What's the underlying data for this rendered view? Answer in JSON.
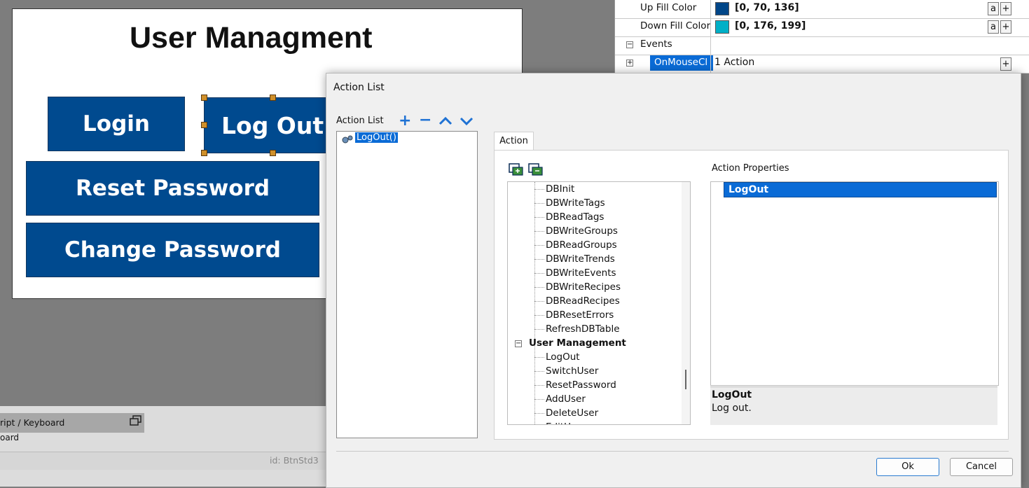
{
  "hmi": {
    "title": "User Managment",
    "buttons": {
      "login": "Login",
      "logout": "Log Out",
      "reset_password": "Reset Password",
      "change_password": "Change Password"
    }
  },
  "properties": {
    "up_fill_color": {
      "label": "Up Fill Color",
      "value": "[0, 70, 136]",
      "color": "#004688"
    },
    "down_fill_color": {
      "label": "Down Fill Color",
      "value": "[0, 176, 199]",
      "color": "#00b0c7"
    },
    "events": {
      "label": "Events"
    },
    "on_mouse_click": {
      "label": "OnMouseCl",
      "value": "1 Action"
    },
    "mini_a": "a",
    "mini_plus": "+",
    "expand_minus": "−",
    "expand_plus": "+"
  },
  "bottom_panel": {
    "tab_label": "ript / Keyboard",
    "sub_tab": "oard",
    "status_id": "id:  BtnStd3"
  },
  "dialog": {
    "title": "Action List",
    "action_list_label": "Action List",
    "toolbar": {
      "add": "+",
      "remove": "−",
      "up": "⌃",
      "down": "⌄"
    },
    "action_list_items": [
      "LogOut()"
    ],
    "tab_action": "Action",
    "tree": {
      "items": [
        "DBInit",
        "DBWriteTags",
        "DBReadTags",
        "DBWriteGroups",
        "DBReadGroups",
        "DBWriteTrends",
        "DBWriteEvents",
        "DBWriteRecipes",
        "DBReadRecipes",
        "DBResetErrors",
        "RefreshDBTable"
      ],
      "group": "User Management",
      "group_toggle": "−",
      "group_items": [
        "LogOut",
        "SwitchUser",
        "ResetPassword",
        "AddUser",
        "DeleteUser",
        "EditUser"
      ]
    },
    "action_properties_label": "Action Properties",
    "selected_property": "LogOut",
    "description_title": "LogOut",
    "description_text": "Log out.",
    "ok": "Ok",
    "cancel": "Cancel"
  },
  "colors": {
    "button_blue": "#004a8f",
    "selection_blue": "#0a6bd6",
    "toolbar_blue": "#1f72d4"
  }
}
